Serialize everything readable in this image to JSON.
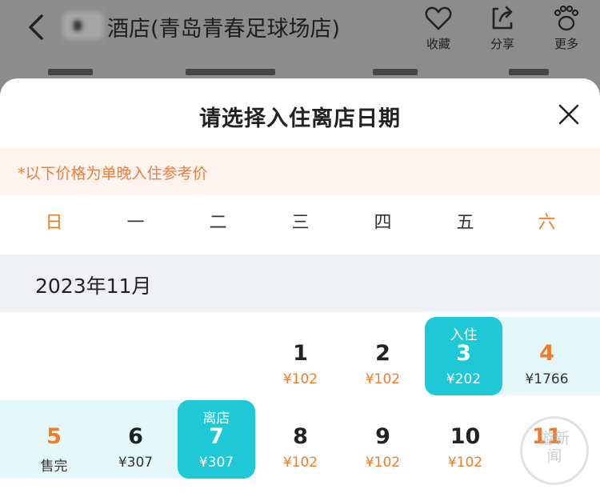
{
  "header": {
    "hotel_name": "酒店(青岛青春足球场店)",
    "actions": [
      {
        "label": "收藏",
        "icon": "heart-icon"
      },
      {
        "label": "分享",
        "icon": "share-icon"
      },
      {
        "label": "更多",
        "icon": "footprint-icon"
      }
    ]
  },
  "sheet": {
    "title": "请选择入住离店日期",
    "note": "*以下价格为单晚入住参考价",
    "weekdays": [
      "日",
      "一",
      "二",
      "三",
      "四",
      "五",
      "六"
    ],
    "month": "2023年11月",
    "days": [
      {
        "day": "1",
        "price": "¥102"
      },
      {
        "day": "2",
        "price": "¥102"
      },
      {
        "day": "3",
        "price": "¥202",
        "tag": "入住"
      },
      {
        "day": "4",
        "price": "¥1766"
      },
      {
        "day": "5",
        "price": "售完"
      },
      {
        "day": "6",
        "price": "¥307"
      },
      {
        "day": "7",
        "price": "¥307",
        "tag": "离店"
      },
      {
        "day": "8",
        "price": "¥102"
      },
      {
        "day": "9",
        "price": "¥102"
      },
      {
        "day": "10",
        "price": "¥102"
      },
      {
        "day": "11",
        "price": ""
      }
    ]
  },
  "watermark": "游新闻",
  "colors": {
    "accent": "#1ec8d7",
    "weekend": "#f07b28",
    "range": "#e4f8f9"
  }
}
